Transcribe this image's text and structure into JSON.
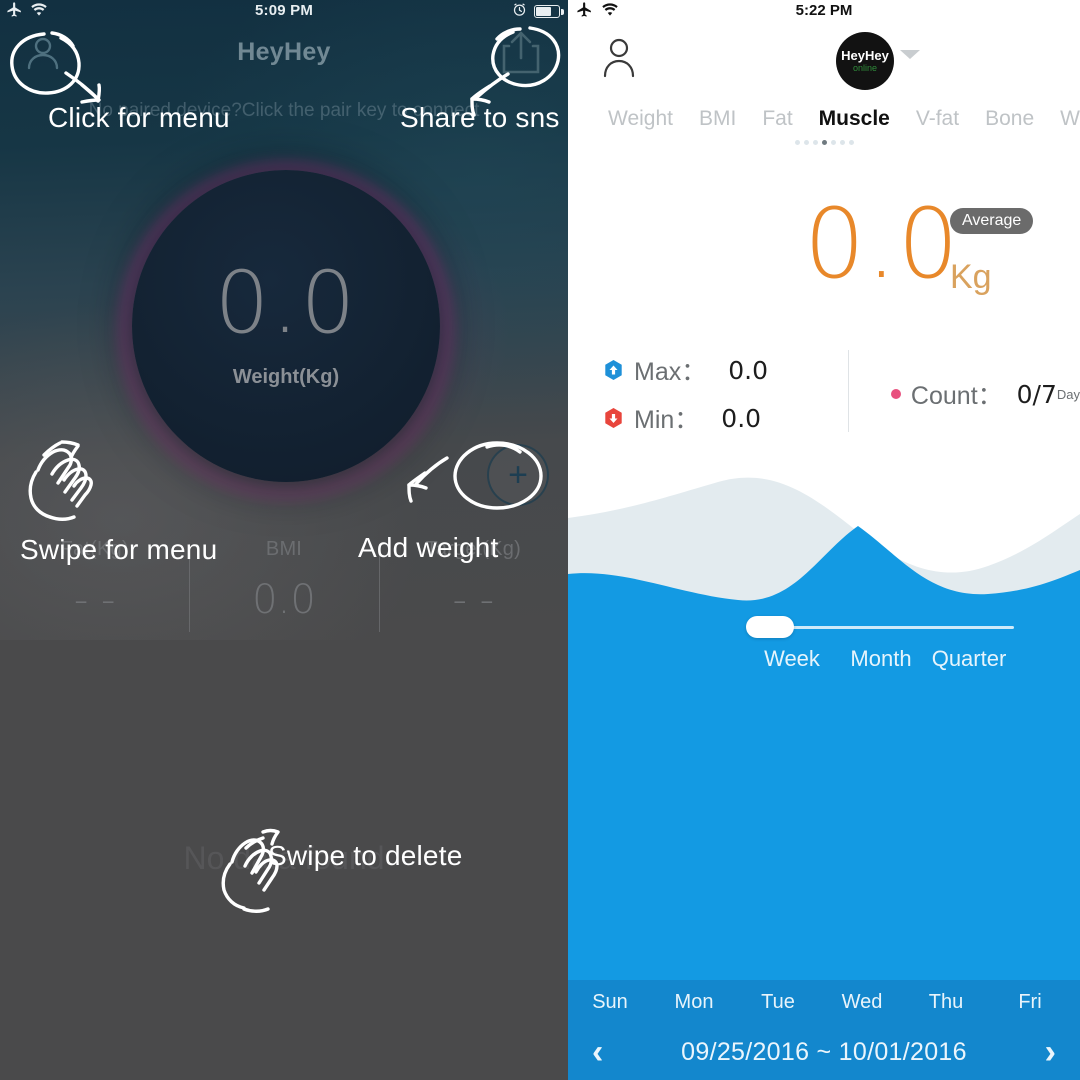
{
  "left_panel": {
    "status_bar": {
      "time": "5:09 PM",
      "airplane_icon": "airplane-icon",
      "wifi_icon": "wifi-icon",
      "alarm_icon": "alarm-clock-icon",
      "battery_icon": "battery-icon"
    },
    "title": "HeyHey",
    "pair_hint": "No paired device?Click the pair key to connect",
    "avatar_icon": "person-icon",
    "share_icon": "share-icon",
    "dial": {
      "value": "0.0",
      "label": "Weight(Kg)"
    },
    "fab_icon": "plus-icon",
    "stats": [
      {
        "label": "Fat(Kg)",
        "value": "- -"
      },
      {
        "label": "BMI",
        "value": "0.0"
      },
      {
        "label": "Target(Kg)",
        "value": "- -"
      }
    ],
    "empty_state": "No data found",
    "annotations": {
      "click_for_menu": "Click for menu",
      "share_to_sns": "Share to sns",
      "swipe_for_menu": "Swipe for menu",
      "add_weight": "Add weight",
      "swipe_to_delete": "Swipe to delete"
    }
  },
  "right_panel": {
    "status_bar": {
      "time": "5:22 PM",
      "airplane_icon": "airplane-icon",
      "wifi_icon": "wifi-icon"
    },
    "person_icon": "person-icon",
    "avatar": {
      "name": "HeyHey",
      "status": "online"
    },
    "caret_icon": "chevron-down-icon",
    "tabs": [
      {
        "label": "Weight",
        "active": false
      },
      {
        "label": "BMI",
        "active": false
      },
      {
        "label": "Fat",
        "active": false
      },
      {
        "label": "Muscle",
        "active": true
      },
      {
        "label": "V-fat",
        "active": false
      },
      {
        "label": "Bone",
        "active": false
      },
      {
        "label": "W",
        "active": false
      }
    ],
    "page_dots": {
      "total": 7,
      "active_index": 3
    },
    "reading": {
      "value": "0.0",
      "unit": "Kg",
      "badge": "Average"
    },
    "stats": {
      "max_label": "Max：",
      "max_value": "0.0",
      "max_icon": "hex-up-icon",
      "min_label": "Min：",
      "min_value": "0.0",
      "min_icon": "hex-down-icon",
      "count_label": "Count：",
      "count_value": "0/7",
      "count_unit": "Day",
      "count_icon": "dot-icon"
    },
    "range_slider": {
      "selected": "Week",
      "options": [
        "Week",
        "Month",
        "Quarter"
      ]
    },
    "days": [
      "Sun",
      "Mon",
      "Tue",
      "Wed",
      "Thu",
      "Fri"
    ],
    "date_range": "09/25/2016 ~ 10/01/2016",
    "prev_icon": "chevron-left-icon",
    "next_icon": "chevron-right-icon"
  },
  "colors": {
    "accent_orange": "#e8882a",
    "wave_blue": "#139ae3",
    "wave_light": "#e3ebef",
    "bar_blue": "#1387cd",
    "max_blue": "#1e90d8",
    "min_red": "#e8453c",
    "count_pink": "#e8507e",
    "left_bg": "#4a4a4b"
  }
}
